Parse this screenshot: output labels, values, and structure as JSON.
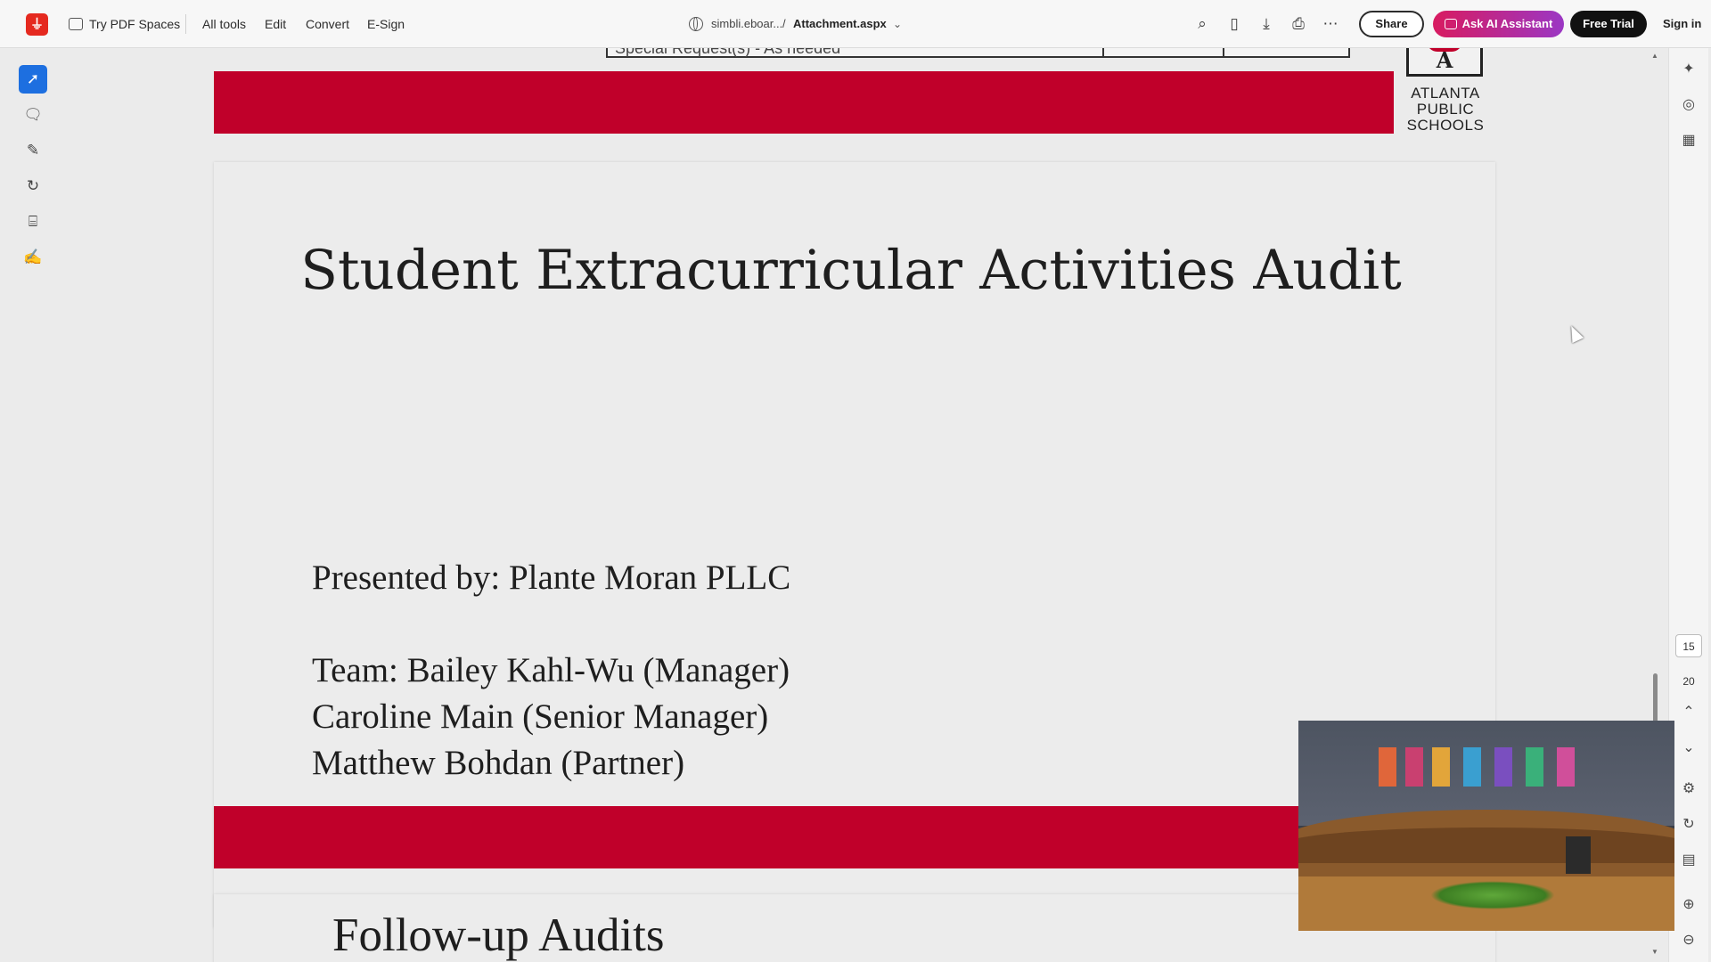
{
  "toolbar": {
    "try_spaces": "Try PDF Spaces",
    "menu": [
      "All tools",
      "Edit",
      "Convert",
      "E-Sign"
    ],
    "breadcrumb_site": "simbli.eboar...",
    "breadcrumb_sep": "/",
    "breadcrumb_file": "Attachment.aspx",
    "share_label": "Share",
    "ask_label": "Ask AI Assistant",
    "trial_label": "Free Trial",
    "signin_label": "Sign in"
  },
  "document": {
    "prev_page_text": "Special Request(s) - As needed",
    "logo_lines": [
      "ATLANTA",
      "PUBLIC",
      "SCHOOLS"
    ],
    "logo_letter": "A",
    "title": "Student Extracurricular Activities Audit",
    "presented_by": "Presented by: Plante Moran PLLC",
    "team_lines": [
      "Team: Bailey Kahl-Wu (Manager)",
      "Caroline Main (Senior Manager)",
      "Matthew Bohdan (Partner)"
    ],
    "next_page_heading": "Follow-up Audits"
  },
  "page_nav": {
    "current_page": "15",
    "total_pages": "20"
  },
  "colors": {
    "accent_red": "#c0002a",
    "selected_tool": "#1d6fe0"
  },
  "icons": {
    "left_rail": [
      "select-arrow-icon",
      "comment-icon",
      "pen-icon",
      "lasso-icon",
      "text-select-icon",
      "sign-icon"
    ],
    "top_tools": [
      "search-icon",
      "page-view-icon",
      "download-icon",
      "print-icon",
      "more-icon"
    ],
    "right_rail": [
      "ai-panel-icon",
      "comments-panel-icon",
      "grid-icon",
      "scroll-up-icon",
      "scroll-down-icon",
      "settings-icon",
      "rotate-icon",
      "page-info-icon",
      "zoom-in-icon",
      "zoom-out-icon"
    ]
  }
}
